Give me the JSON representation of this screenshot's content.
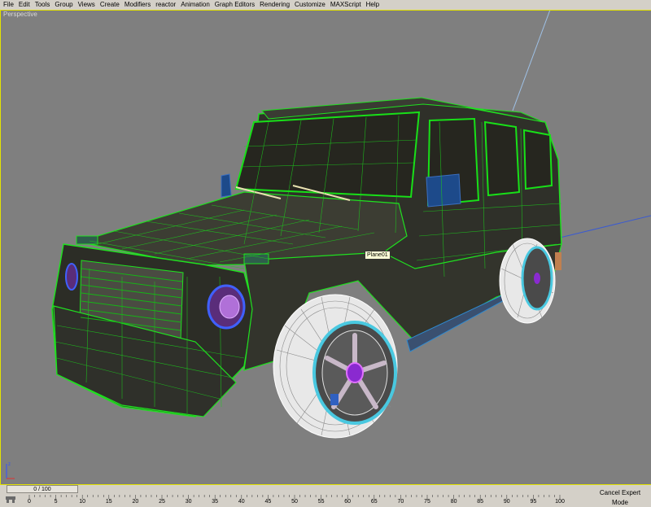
{
  "menu": [
    "File",
    "Edit",
    "Tools",
    "Group",
    "Views",
    "Create",
    "Modifiers",
    "reactor",
    "Animation",
    "Graph Editors",
    "Rendering",
    "Customize",
    "MAXScript",
    "Help"
  ],
  "viewport": {
    "label": "Perspective",
    "object_label": "Plane01",
    "wire_color": "#00e000",
    "border_color": "#e3e300",
    "background": "#7f7f7f"
  },
  "timeline": {
    "slider_text": "0 / 100",
    "ticks": [
      "0",
      "5",
      "10",
      "15",
      "20",
      "25",
      "30",
      "35",
      "40",
      "45",
      "50",
      "55",
      "60",
      "65",
      "70",
      "75",
      "80",
      "85",
      "90",
      "95",
      "100"
    ]
  },
  "status": {
    "cancel_expert": "Cancel Expert Mode"
  }
}
